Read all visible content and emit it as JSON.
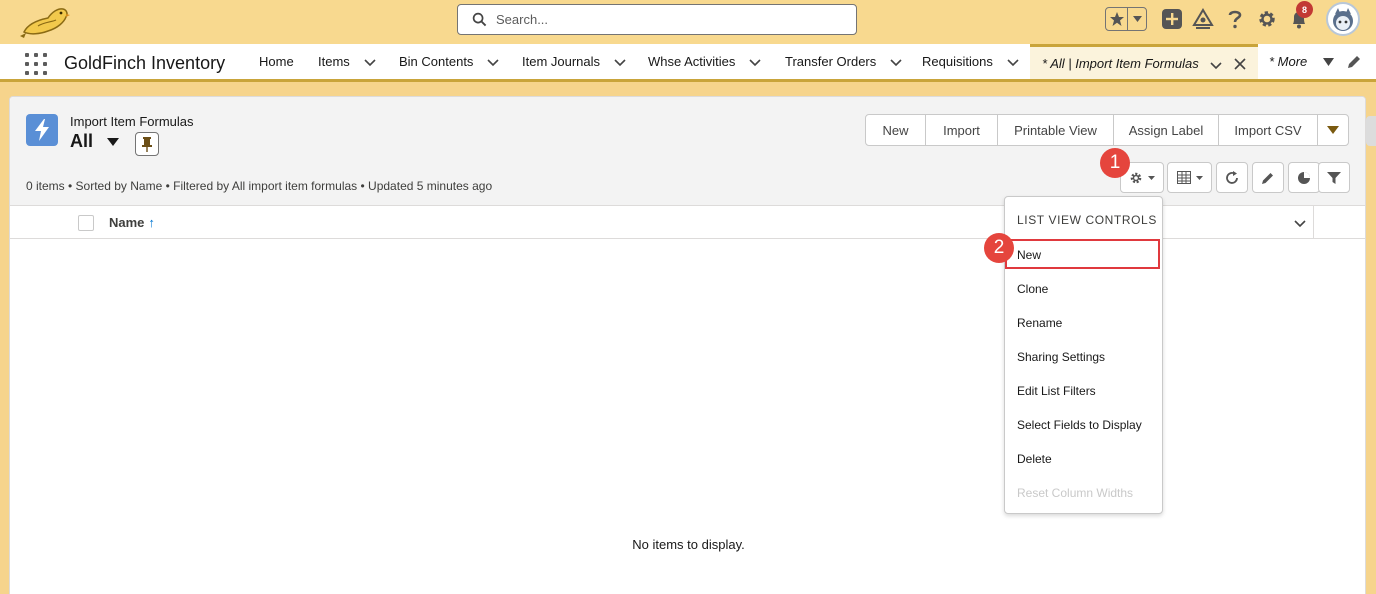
{
  "header": {
    "search_placeholder": "Search...",
    "notification_count": "8",
    "brand_color": "#f8d98f"
  },
  "nav": {
    "app_name": "GoldFinch Inventory",
    "items": [
      {
        "label": "Home",
        "has_menu": false
      },
      {
        "label": "Items",
        "has_menu": true
      },
      {
        "label": "Bin Contents",
        "has_menu": true
      },
      {
        "label": "Item Journals",
        "has_menu": true
      },
      {
        "label": "Whse Activities",
        "has_menu": true
      },
      {
        "label": "Transfer Orders",
        "has_menu": true
      },
      {
        "label": "Requisitions",
        "has_menu": true
      }
    ],
    "active_tab": "* All | Import Item Formulas",
    "more_label": "* More"
  },
  "list_view": {
    "object_label": "Import Item Formulas",
    "view_name": "All",
    "meta": "0 items • Sorted by Name • Filtered by All import item formulas • Updated 5 minutes ago",
    "buttons": [
      "New",
      "Import",
      "Printable View",
      "Assign Label",
      "Import CSV"
    ],
    "column_name": "Name",
    "sort_arrow": "↑",
    "empty_message": "No items to display."
  },
  "menu": {
    "heading": "LIST VIEW CONTROLS",
    "items": [
      {
        "label": "New",
        "disabled": false
      },
      {
        "label": "Clone",
        "disabled": false
      },
      {
        "label": "Rename",
        "disabled": false
      },
      {
        "label": "Sharing Settings",
        "disabled": false
      },
      {
        "label": "Edit List Filters",
        "disabled": false
      },
      {
        "label": "Select Fields to Display",
        "disabled": false
      },
      {
        "label": "Delete",
        "disabled": false
      },
      {
        "label": "Reset Column Widths",
        "disabled": true
      }
    ]
  },
  "markers": [
    "1",
    "2"
  ]
}
